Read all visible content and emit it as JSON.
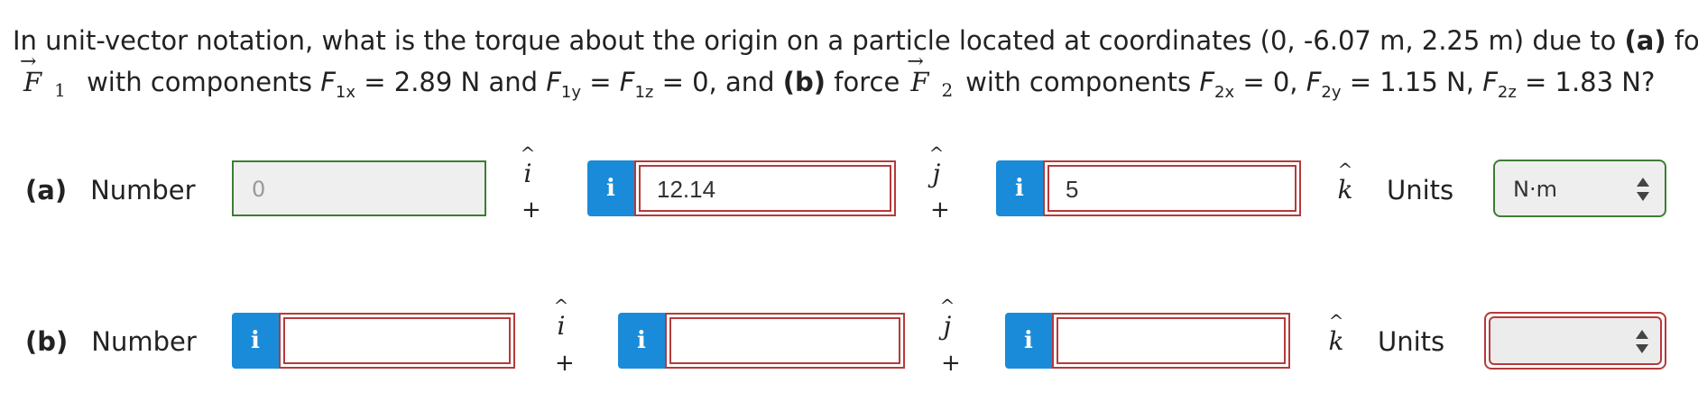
{
  "question": {
    "line1": "In unit-vector notation, what is the torque about the origin on a particle located at coordinates (0, -6.07 m, 2.25 m) due to ",
    "part_a_marker": "(a)",
    "line1_end": " force",
    "vec1_symbol": "F",
    "vec1_sub": "1",
    "line2_a": " with components ",
    "f1x_sym": "F",
    "f1x_sub": "1x",
    "f1x_val": " = 2.89 N and ",
    "f1y_sym": "F",
    "f1y_sub": "1y",
    "eq1": " = ",
    "f1z_sym": "F",
    "f1z_sub": "1z",
    "f1z_val": " = 0, and ",
    "part_b_marker": "(b)",
    "force_word": " force",
    "vec2_symbol": "F",
    "vec2_sub": "2",
    "line2_b": "with components ",
    "f2x_sym": "F",
    "f2x_sub": "2x",
    "f2x_val": " = 0, ",
    "f2y_sym": "F",
    "f2y_sub": "2y",
    "f2y_val": " = 1.15 N, ",
    "f2z_sym": "F",
    "f2z_sub": "2z",
    "f2z_val": " = 1.83 N?"
  },
  "arrow": "→",
  "hat": "^",
  "unit_i": "i",
  "unit_j": "j",
  "unit_k": "k",
  "plus": "+",
  "info_glyph": "i",
  "rows": {
    "a": {
      "marker": "(a)",
      "label": "Number",
      "i_value": "0",
      "j_value": "12.14",
      "k_value": "5",
      "units_label": "Units",
      "units_value": "N·m"
    },
    "b": {
      "marker": "(b)",
      "label": "Number",
      "i_value": "",
      "j_value": "",
      "k_value": "",
      "units_label": "Units",
      "units_value": ""
    }
  },
  "colors": {
    "info_button": "#1a8bd8",
    "correct_border": "#3d7d34",
    "incorrect_border": "#b53a3a"
  }
}
